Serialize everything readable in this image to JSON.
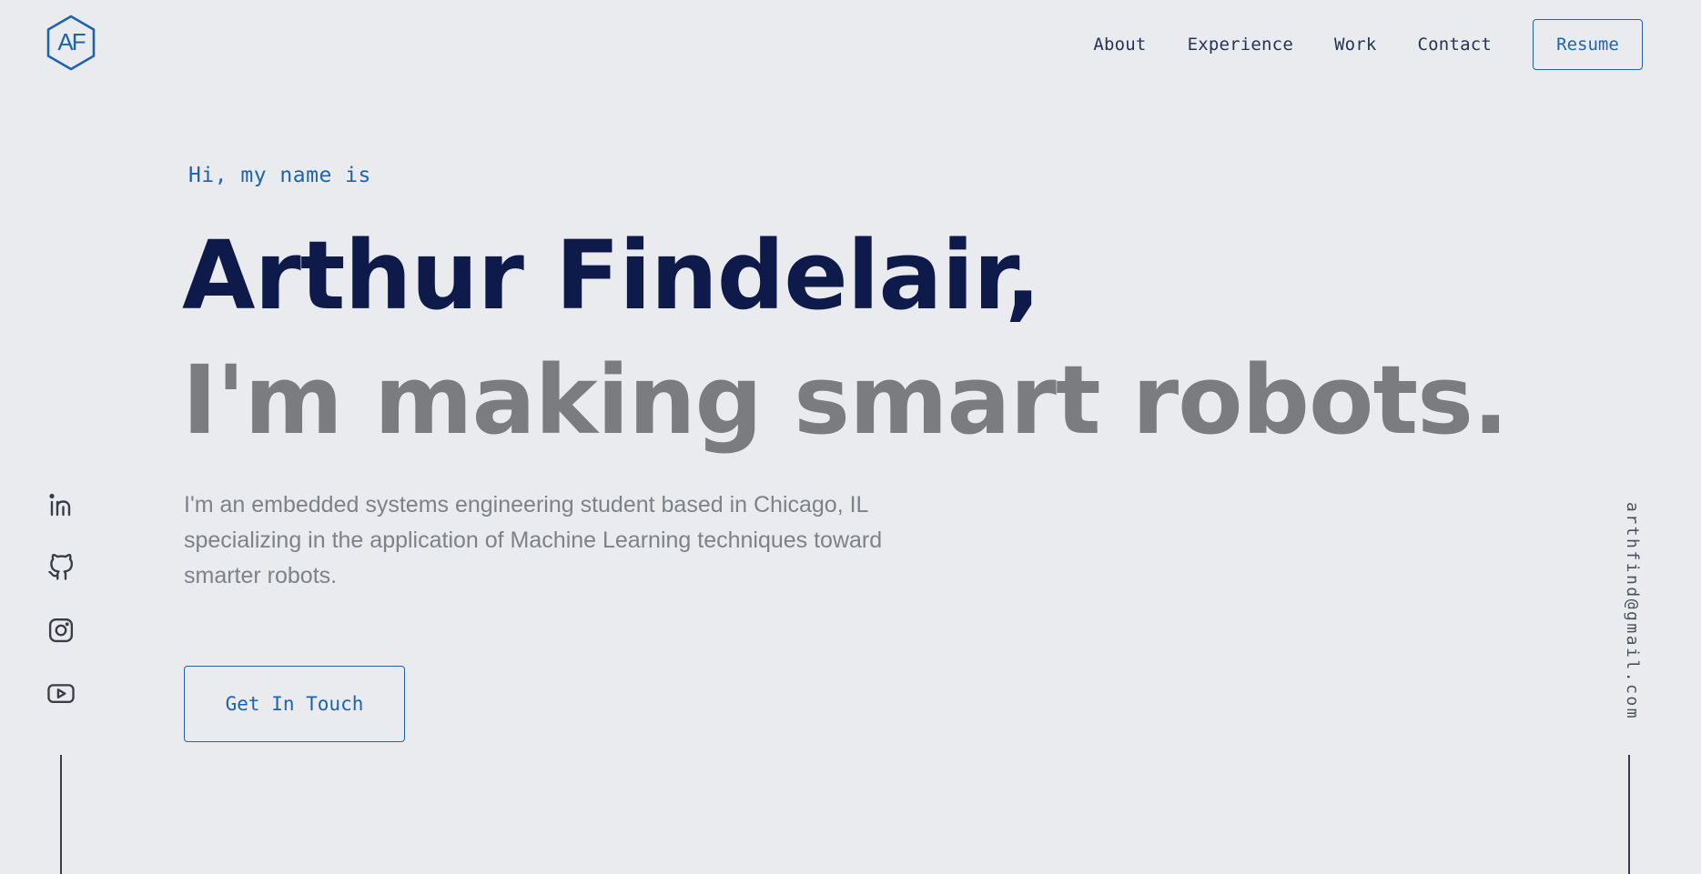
{
  "brand": {
    "logo_text": "AF",
    "logo_icon": "hexagon-logo-icon",
    "accent_color": "#1d63b0"
  },
  "nav": {
    "items": [
      {
        "label": "About"
      },
      {
        "label": "Experience"
      },
      {
        "label": "Work"
      },
      {
        "label": "Contact"
      }
    ],
    "resume_label": "Resume"
  },
  "hero": {
    "greeting": "Hi, my name is",
    "name": "Arthur Findelair,",
    "tagline": "I'm making smart robots.",
    "bio": "I'm an embedded systems engineering student based in Chicago, IL specializing in the application of Machine Learning techniques toward smarter robots.",
    "cta_label": "Get In Touch",
    "name_color": "#0d1a4a",
    "tagline_color": "#7a7c80"
  },
  "social": {
    "icons": [
      "linkedin-icon",
      "github-icon",
      "instagram-icon",
      "youtube-icon"
    ]
  },
  "email": "arthfind@gmail.com",
  "colors": {
    "background": "#e9ebef",
    "text_muted": "#7e8186"
  }
}
